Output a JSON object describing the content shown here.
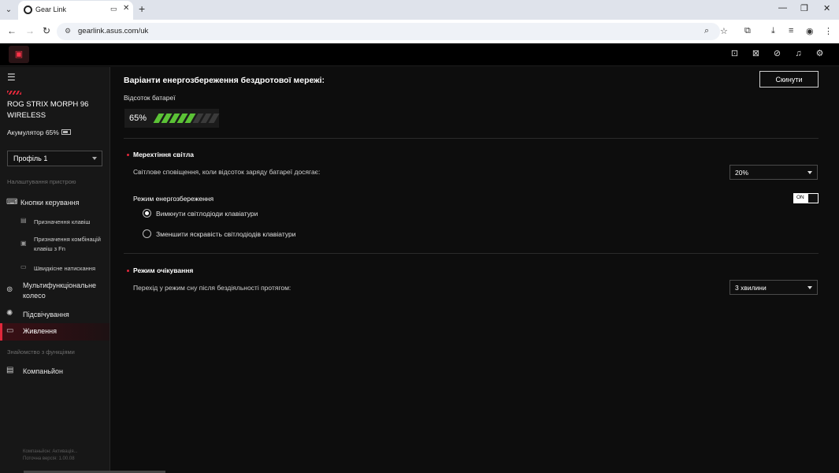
{
  "browser": {
    "tab_title": "Gear Link",
    "url": "gearlink.asus.com/uk"
  },
  "sidebar": {
    "device_name": "ROG STRIX MORPH 96 WIRELESS",
    "battery_label": "Акумулятор 65%",
    "profile": "Профіль 1",
    "section_device": "Налаштування пристрою",
    "items": [
      {
        "label": "Кнопки керування",
        "icon": "keyboard-icon"
      },
      {
        "label": "Призначення клавіш",
        "icon": "keys-icon"
      },
      {
        "label": "Призначення комбінацій клавіш з Fn",
        "icon": "fn-icon"
      },
      {
        "label": "Швидкісне натискання",
        "icon": "rapid-icon"
      },
      {
        "label": "Мультифункціональне колесо",
        "icon": "wheel-icon"
      },
      {
        "label": "Підсвічування",
        "icon": "light-icon"
      },
      {
        "label": "Живлення",
        "icon": "battery-icon"
      }
    ],
    "section_features": "Знайомство з функціями",
    "companion": "Компаньйон",
    "footnote_1": "Компаньйон: Активація...",
    "footnote_2": "Поточна версія: 1.00.08"
  },
  "main": {
    "title": "Варіанти енергозбереження бездротової мережі:",
    "reset_label": "Скинути",
    "battery_label": "Відсоток батареї",
    "battery_percent": "65%",
    "battery_level": 0.65,
    "flicker": {
      "heading": "Мерехтіння світла",
      "desc": "Світлове сповіщення, коли відсоток заряду батареї досягає:",
      "value": "20%"
    },
    "power_saving": {
      "heading": "Режим енергозбереження",
      "toggle": "ON",
      "option_1": "Вимкнути світлодіоди клавіатури",
      "option_2": "Зменшити яскравість світлодіодів клавіатури"
    },
    "standby": {
      "heading": "Режим очікування",
      "desc": "Перехід у режим сну після бездіяльності протягом:",
      "value": "3 хвилини"
    }
  },
  "colors": {
    "accent": "#e0283b",
    "battery_fill": "#5bc236"
  }
}
